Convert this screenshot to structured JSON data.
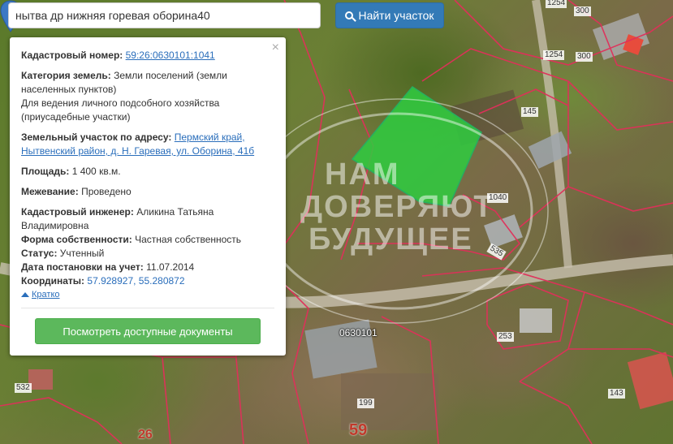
{
  "search": {
    "query": "нытва др нижняя горевая оборина40",
    "button_label": "Найти участок"
  },
  "popup": {
    "close_label": "×",
    "cadastral_number_label": "Кадастровый номер:",
    "cadastral_number_value": "59:26:0630101:1041",
    "land_category_label": "Категория земель:",
    "land_category_value": "Земли поселений (земли населенных пунктов)",
    "land_use": "Для ведения личного подсобного хозяйства (приусадебные участки)",
    "address_label": "Земельный участок по адресу:",
    "address_value": "Пермский край, Нытвенский район, д. Н. Гаревая, ул. Оборина, 41б",
    "area_label": "Площадь:",
    "area_value": "1 400 кв.м.",
    "survey_label": "Межевание:",
    "survey_value": "Проведено",
    "engineer_label": "Кадастровый инженер:",
    "engineer_value": "Аликина Татьяна Владимировна",
    "ownership_label": "Форма собственности:",
    "ownership_value": "Частная собственность",
    "status_label": "Статус:",
    "status_value": "Учтенный",
    "registered_label": "Дата постановки на учет:",
    "registered_value": "11.07.2014",
    "coords_label": "Координаты:",
    "coords_value": "57.928927, 55.280872",
    "collapse_label": "Кратко",
    "docs_button_label": "Посмотреть доступные документы"
  },
  "map": {
    "labels": {
      "n1254a": "1254",
      "n300a": "300",
      "n1254b": "1254",
      "n300b": "300",
      "n145": "145",
      "n1040": "1040",
      "n535": "535",
      "n0630101": "0630101",
      "n253": "253",
      "n143": "143",
      "n532": "532",
      "n199": "199",
      "n26": "26",
      "n59": "59"
    },
    "watermark": [
      "НАМ",
      "ДОВЕРЯЮТ",
      "БУДУЩЕЕ"
    ],
    "selected_parcel_color": "#2ecc40",
    "boundary_color": "#e0305a"
  }
}
